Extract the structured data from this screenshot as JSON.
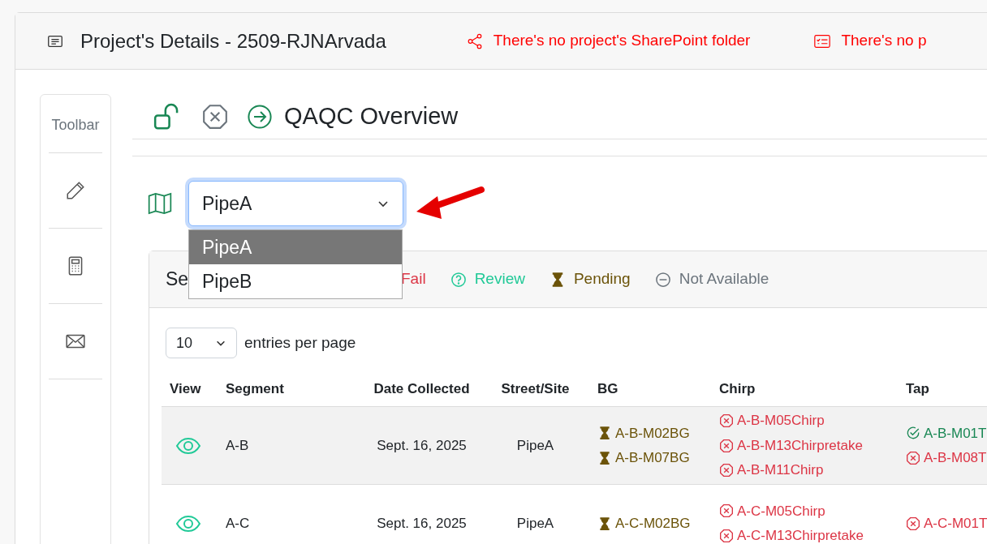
{
  "header": {
    "title": "Project's Details - 2509-RJNArvada",
    "warnings": [
      {
        "kind": "share",
        "text": "There's no project's SharePoint folder"
      },
      {
        "kind": "checklist",
        "text": "There's no p"
      }
    ]
  },
  "toolbar": {
    "title": "Toolbar",
    "tools": [
      {
        "kind": "pencil"
      },
      {
        "kind": "calculator"
      },
      {
        "kind": "mail"
      }
    ]
  },
  "page_title": "QAQC Overview",
  "pipe_select": {
    "value": "PipeA",
    "expanded": true,
    "options": [
      {
        "label": "PipeA",
        "selected": true
      },
      {
        "label": "PipeB",
        "selected": false
      }
    ]
  },
  "status_card": {
    "title": "Se",
    "legend": [
      {
        "kind": "fail",
        "label": "Fail"
      },
      {
        "kind": "review",
        "label": "Review"
      },
      {
        "kind": "pending",
        "label": "Pending"
      },
      {
        "kind": "na",
        "label": "Not Available"
      }
    ]
  },
  "entries": {
    "value": "10",
    "label": "entries per page"
  },
  "table": {
    "columns": [
      "View",
      "Segment",
      "Date Collected",
      "Street/Site",
      "BG",
      "Chirp",
      "Tap"
    ],
    "rows": [
      {
        "segment": "A-B",
        "date": "Sept. 16, 2025",
        "site": "PipeA",
        "bg": [
          {
            "kind": "pending",
            "text": "A-B-M02BG"
          },
          {
            "kind": "pending",
            "text": "A-B-M07BG"
          }
        ],
        "chirp": [
          {
            "kind": "fail",
            "text": "A-B-M05Chirp"
          },
          {
            "kind": "fail",
            "text": "A-B-M13Chirpretake"
          },
          {
            "kind": "fail",
            "text": "A-B-M11Chirp"
          }
        ],
        "tap": [
          {
            "kind": "pass",
            "text": "A-B-M01T"
          },
          {
            "kind": "fail",
            "text": "A-B-M08T"
          }
        ]
      },
      {
        "segment": "A-C",
        "date": "Sept. 16, 2025",
        "site": "PipeA",
        "bg": [
          {
            "kind": "pending",
            "text": "A-C-M02BG"
          }
        ],
        "chirp": [
          {
            "kind": "fail",
            "text": "A-C-M05Chirp"
          },
          {
            "kind": "fail",
            "text": "A-C-M13Chirpretake"
          }
        ],
        "tap": [
          {
            "kind": "fail",
            "text": "A-C-M01T"
          }
        ]
      }
    ]
  }
}
